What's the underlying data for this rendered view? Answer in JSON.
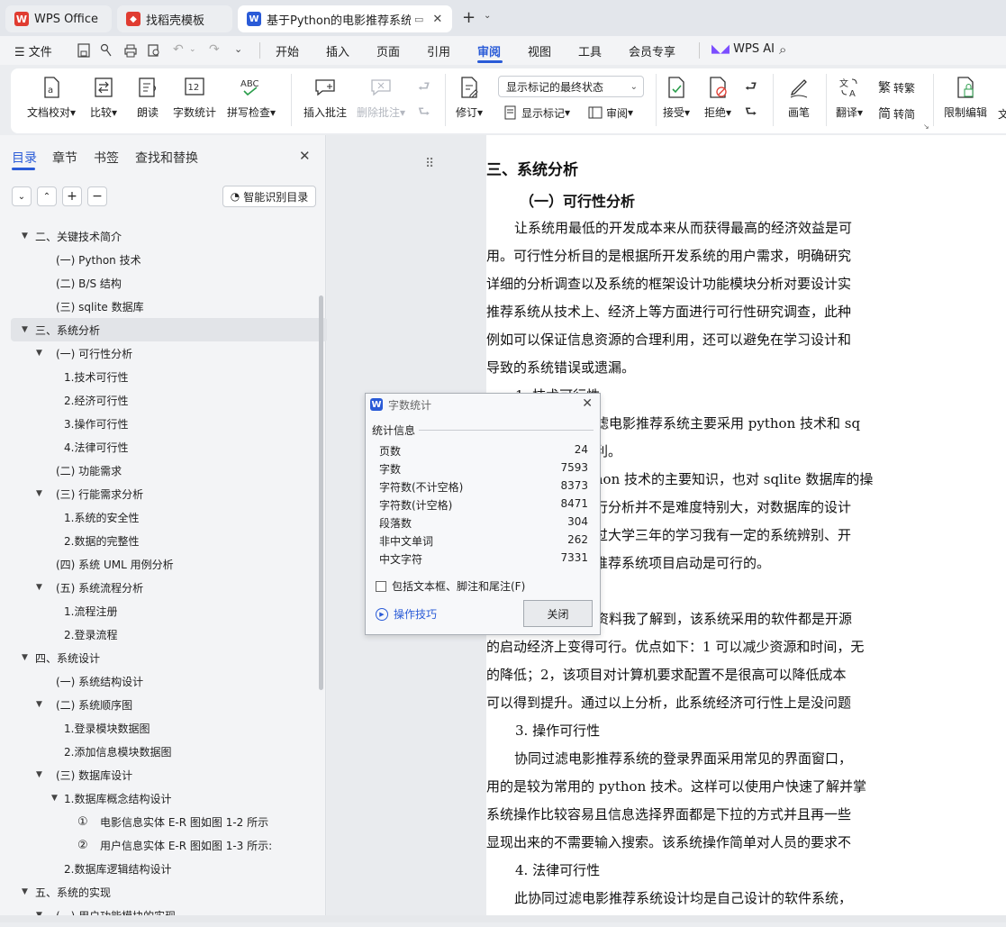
{
  "tabs": [
    {
      "label": "WPS Office"
    },
    {
      "label": "找稻壳模板"
    },
    {
      "label": "基于Python的电影推荐系统的"
    }
  ],
  "menubar": {
    "file": "文件",
    "items": [
      "开始",
      "插入",
      "页面",
      "引用",
      "审阅",
      "视图",
      "工具",
      "会员专享"
    ],
    "wps_ai": "WPS AI"
  },
  "ribbon": {
    "doc_check": "文档校对",
    "compare": "比较",
    "read_aloud": "朗读",
    "word_count": "字数统计",
    "spell_check": "拼写检查",
    "insert_comment": "插入批注",
    "delete_comment": "删除批注",
    "markup_select": "显示标记的最终状态",
    "revise": "修订",
    "show_markup": "显示标记",
    "review": "审阅",
    "accept": "接受",
    "reject": "拒绝",
    "pen": "画笔",
    "translate": "翻译",
    "to_traditional": "转繁",
    "to_simplified": "转简",
    "restrict_edit": "限制编辑",
    "cut_text": "文",
    "icon_word_count_text": "12",
    "icon_spell_text": "ABC"
  },
  "sidebar": {
    "tabs": [
      "目录",
      "章节",
      "书签",
      "查找和替换"
    ],
    "smart_toc": "智能识别目录",
    "toc": [
      {
        "label": "二、关键技术简介"
      },
      {
        "label": "(一) Python 技术"
      },
      {
        "label": "(二) B/S 结构"
      },
      {
        "label": "(三) sqlite 数据库"
      },
      {
        "label": "三、系统分析"
      },
      {
        "label": "(一) 可行性分析"
      },
      {
        "label": "1.技术可行性"
      },
      {
        "label": "2.经济可行性"
      },
      {
        "label": "3.操作可行性"
      },
      {
        "label": "4.法律可行性"
      },
      {
        "label": "(二) 功能需求"
      },
      {
        "label": "(三) 行能需求分析"
      },
      {
        "label": "1.系统的安全性"
      },
      {
        "label": "2.数据的完整性"
      },
      {
        "label": "(四) 系统 UML 用例分析"
      },
      {
        "label": "(五) 系统流程分析"
      },
      {
        "label": "1.流程注册"
      },
      {
        "label": "2.登录流程"
      },
      {
        "label": "四、系统设计"
      },
      {
        "label": "(一) 系统结构设计"
      },
      {
        "label": "(二) 系统顺序图"
      },
      {
        "label": "1.登录模块数据图"
      },
      {
        "label": "2.添加信息模块数据图"
      },
      {
        "label": "(三) 数据库设计"
      },
      {
        "label": "1.数据库概念结构设计"
      },
      {
        "label": "电影信息实体 E-R 图如图 1-2 所示"
      },
      {
        "label": "用户信息实体 E-R 图如图 1-3 所示:"
      },
      {
        "label": "2.数据库逻辑结构设计"
      },
      {
        "label": "五、系统的实现"
      },
      {
        "label": "(一) 用户功能模块的实现"
      }
    ],
    "markers": [
      "①",
      "②"
    ]
  },
  "document": {
    "lines": [
      "三、系统分析",
      "（一）可行性分析",
      "让系统用最低的开发成本来从而获得最高的经济效益是可",
      "用。可行性分析目的是根据所开发系统的用户需求，明确研究",
      "详细的分析调查以及系统的框架设计功能模块分析对要设计实",
      "推荐系统从技术上、经济上等方面进行可行性研究调查，此种",
      "例如可以保证信息资源的合理利用，还可以避免在学习设计和",
      "导致的系统错误或遗漏。",
      "1.  技术可行性",
      "首先该协同过滤电影推荐系统主要采用 python 技术和 sq",
      "工具，使用非常便利。",
      "我掌握了 python 技术的主要知识，也对 sqlite 数据库的操",
      "本系统从整体上进行分析并不是难度特别大，对数据库的设计",
      "发的主要难点。通过大学三年的学习我有一定的系统辨别、开",
      "此本协同过滤电影推荐系统项目启动是可行的。",
      "2.  经济可行性",
      "通过查阅相关资料我了解到，该系统采用的软件都是开源",
      "的启动经济上变得可行。优点如下：1 可以减少资源和时间，无",
      "的降低；2，该项目对计算机要求配置不是很高可以降低成本",
      "可以得到提升。通过以上分析，此系统经济可行性上是没问题",
      "3.  操作可行性",
      "协同过滤电影推荐系统的登录界面采用常见的界面窗口，",
      "用的是较为常用的 python 技术。这样可以使用户快速了解并掌",
      "系统操作比较容易且信息选择界面都是下拉的方式并且再一些",
      "显现出来的不需要输入搜索。该系统操作简单对人员的要求不",
      "4.  法律可行性",
      "此协同过滤电影推荐系统设计均是自己设计的软件系统，"
    ]
  },
  "dialog": {
    "title": "字数统计",
    "section": "统计信息",
    "stats": [
      {
        "label": "页数",
        "value": "24"
      },
      {
        "label": "字数",
        "value": "7593"
      },
      {
        "label": "字符数(不计空格)",
        "value": "8373"
      },
      {
        "label": "字符数(计空格)",
        "value": "8471"
      },
      {
        "label": "段落数",
        "value": "304"
      },
      {
        "label": "非中文单词",
        "value": "262"
      },
      {
        "label": "中文字符",
        "value": "7331"
      }
    ],
    "checkbox_label": "包括文本框、脚注和尾注(F)",
    "tips": "操作技巧",
    "close": "关闭"
  },
  "colors": {
    "accent": "#2b579a",
    "wps_red": "#e03c31",
    "tab_blue": "#2a5bd7"
  }
}
